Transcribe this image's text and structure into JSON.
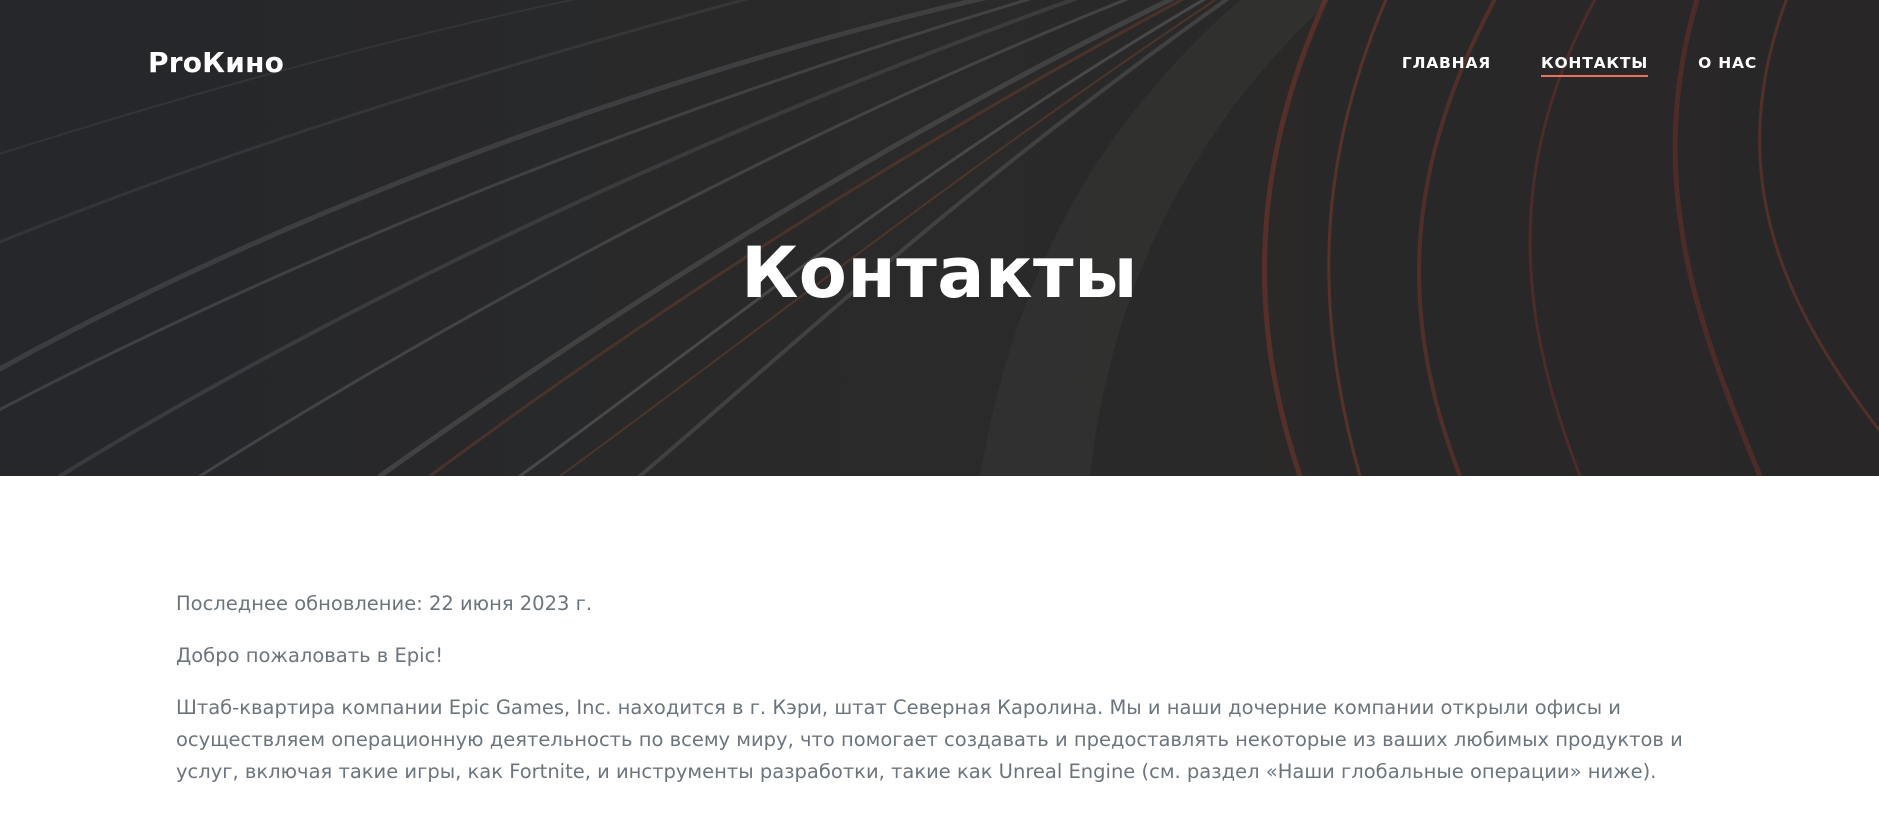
{
  "navbar": {
    "brand": "ProКино",
    "links": [
      {
        "label": "ГЛАВНАЯ",
        "active": false
      },
      {
        "label": "КОНТАКТЫ",
        "active": true
      },
      {
        "label": "О НАС",
        "active": false
      }
    ],
    "active_underline_color": "#e8735a"
  },
  "hero": {
    "title": "Контакты",
    "background_image": "night-highway-light-trails"
  },
  "content": {
    "updated": "Последнее обновление: 22 июня 2023 г.",
    "welcome": "Добро пожаловать в Epic!",
    "body": "Штаб-квартира компании Epic Games, Inc. находится в г. Кэри, штат Северная Каролина. Мы и наши дочерние компании открыли офисы и осуществляем операционную деятельность по всему миру, что помогает создавать и предоставлять некоторые из ваших любимых продуктов и услуг, включая такие игры, как Fortnite, и инструменты разработки, такие как Unreal Engine (см. раздел «Наши глобальные операции» ниже)."
  }
}
